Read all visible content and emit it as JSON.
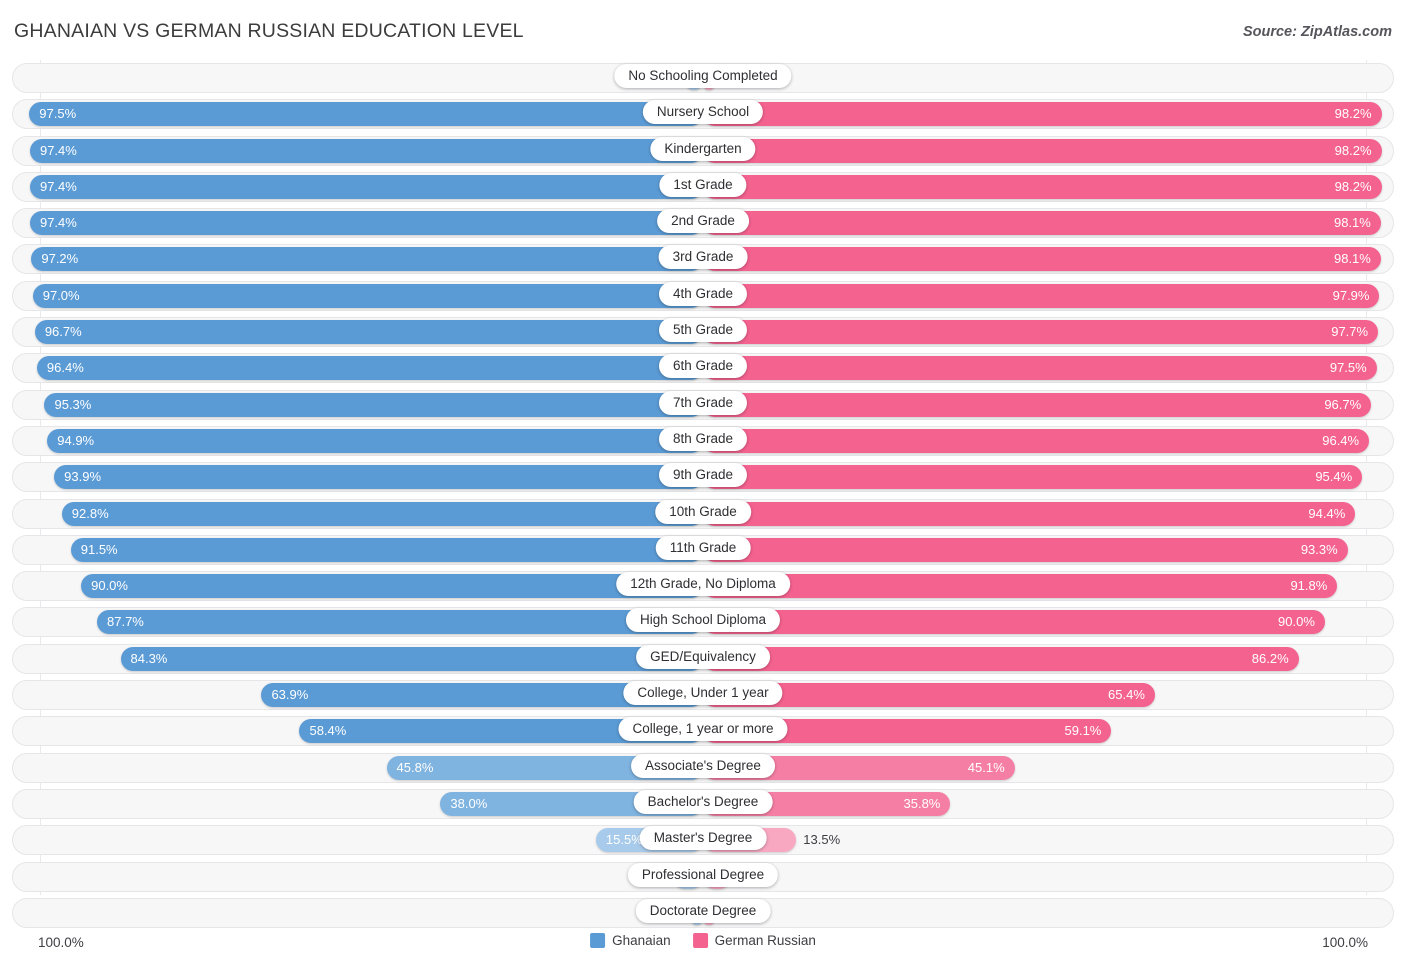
{
  "header": {
    "title": "GHANAIAN VS GERMAN RUSSIAN EDUCATION LEVEL",
    "source": "Source: ZipAtlas.com"
  },
  "footer": {
    "axis_left": "100.0%",
    "axis_right": "100.0%"
  },
  "colors": {
    "blue_strong": "#5b9bd5",
    "blue_mid": "#7fb3e0",
    "blue_light": "#a8cbeb",
    "pink_strong": "#f4628f",
    "pink_mid": "#f57fa4",
    "pink_light": "#f9a8c2",
    "track": "#f7f7f8",
    "track_border": "#e6e6e9",
    "gridline": "#e9e9ec",
    "text": "#3d3d42"
  },
  "chart_data": {
    "type": "bar",
    "orientation": "horizontal-diverging",
    "title": "GHANAIAN VS GERMAN RUSSIAN EDUCATION LEVEL",
    "xlabel": "",
    "ylabel": "",
    "xlim": [
      0,
      100
    ],
    "grid": false,
    "legend_position": "bottom-center",
    "axis_max_label": "100.0%",
    "series": [
      {
        "name": "Ghanaian",
        "color": "#5b9bd5",
        "side": "left",
        "values": [
          2.6,
          97.5,
          97.4,
          97.4,
          97.4,
          97.2,
          97.0,
          96.7,
          96.4,
          95.3,
          94.9,
          93.9,
          92.8,
          91.5,
          90.0,
          87.7,
          84.3,
          63.9,
          58.4,
          45.8,
          38.0,
          15.5,
          4.3,
          1.8
        ]
      },
      {
        "name": "German Russian",
        "color": "#f4628f",
        "side": "right",
        "values": [
          1.8,
          98.2,
          98.2,
          98.2,
          98.1,
          98.1,
          97.9,
          97.7,
          97.5,
          96.7,
          96.4,
          95.4,
          94.4,
          93.3,
          91.8,
          90.0,
          86.2,
          65.4,
          59.1,
          45.1,
          35.8,
          13.5,
          4.0,
          1.8
        ]
      }
    ],
    "categories": [
      "No Schooling Completed",
      "Nursery School",
      "Kindergarten",
      "1st Grade",
      "2nd Grade",
      "3rd Grade",
      "4th Grade",
      "5th Grade",
      "6th Grade",
      "7th Grade",
      "8th Grade",
      "9th Grade",
      "10th Grade",
      "11th Grade",
      "12th Grade, No Diploma",
      "High School Diploma",
      "GED/Equivalency",
      "College, Under 1 year",
      "College, 1 year or more",
      "Associate's Degree",
      "Bachelor's Degree",
      "Master's Degree",
      "Professional Degree",
      "Doctorate Degree"
    ],
    "value_labels_left": [
      "2.6%",
      "97.5%",
      "97.4%",
      "97.4%",
      "97.4%",
      "97.2%",
      "97.0%",
      "96.7%",
      "96.4%",
      "95.3%",
      "94.9%",
      "93.9%",
      "92.8%",
      "91.5%",
      "90.0%",
      "87.7%",
      "84.3%",
      "63.9%",
      "58.4%",
      "45.8%",
      "38.0%",
      "15.5%",
      "4.3%",
      "1.8%"
    ],
    "value_labels_right": [
      "1.8%",
      "98.2%",
      "98.2%",
      "98.2%",
      "98.1%",
      "98.1%",
      "97.9%",
      "97.7%",
      "97.5%",
      "96.7%",
      "96.4%",
      "95.4%",
      "94.4%",
      "93.3%",
      "91.8%",
      "90.0%",
      "86.2%",
      "65.4%",
      "59.1%",
      "45.1%",
      "35.8%",
      "13.5%",
      "4.0%",
      "1.8%"
    ]
  },
  "legend": [
    {
      "label": "Ghanaian",
      "color": "#5b9bd5"
    },
    {
      "label": "German Russian",
      "color": "#f4628f"
    }
  ]
}
